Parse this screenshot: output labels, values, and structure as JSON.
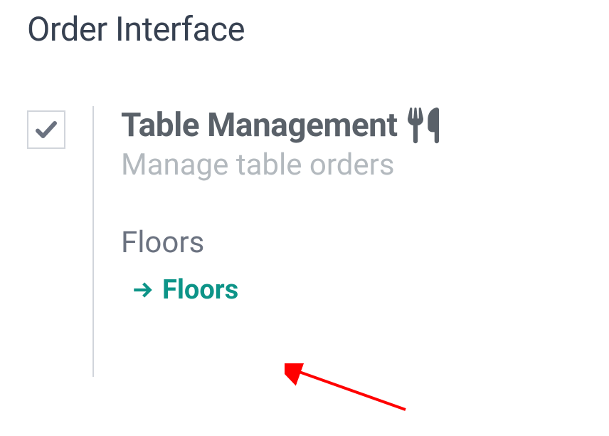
{
  "section": {
    "title": "Order Interface"
  },
  "setting": {
    "title": "Table Management",
    "description": "Manage table orders",
    "checked": true,
    "field_label": "Floors",
    "link_label": "Floors"
  },
  "colors": {
    "accent": "#0d9488"
  }
}
